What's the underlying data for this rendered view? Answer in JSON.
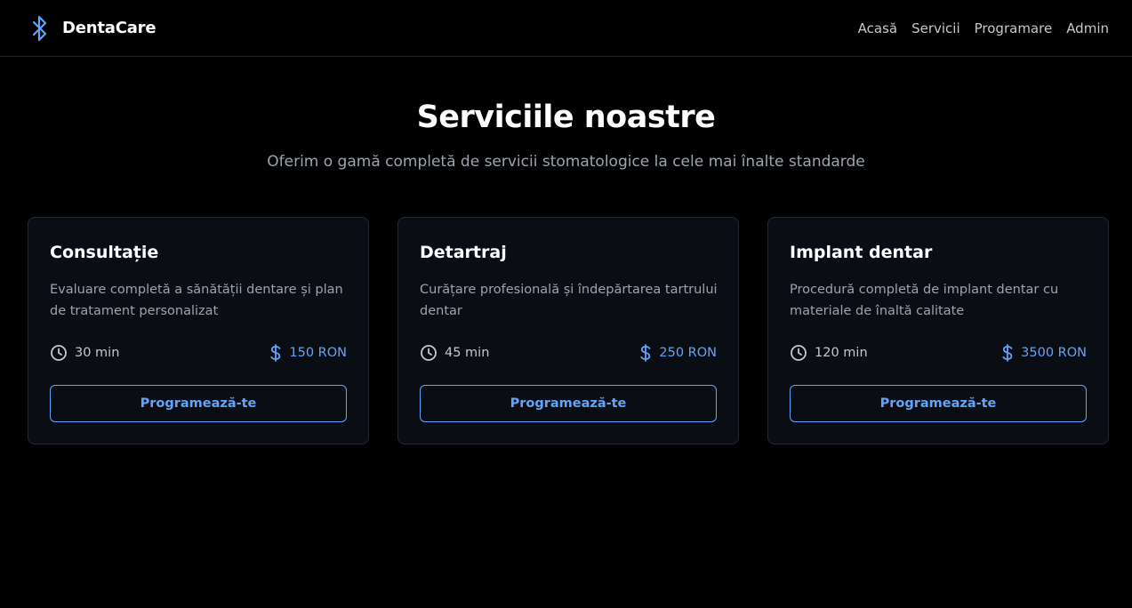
{
  "brand": {
    "name": "DentaCare",
    "icon": "bluetooth-icon"
  },
  "nav": {
    "links": [
      "Acasă",
      "Servicii",
      "Programare",
      "Admin"
    ]
  },
  "hero": {
    "title": "Serviciile noastre",
    "subtitle": "Oferim o gamă completă de servicii stomatologice la cele mai înalte standarde"
  },
  "services": [
    {
      "title": "Consultație",
      "description": "Evaluare completă a sănătății dentare și plan de tratament personalizat",
      "duration": "30 min",
      "price": "150 RON",
      "button": "Programează-te"
    },
    {
      "title": "Detartraj",
      "description": "Curățare profesională și îndepărtarea tartrului dentar",
      "duration": "45 min",
      "price": "250 RON",
      "button": "Programează-te"
    },
    {
      "title": "Implant dentar",
      "description": "Procedură completă de implant dentar cu materiale de înaltă calitate",
      "duration": "120 min",
      "price": "3500 RON",
      "button": "Programează-te"
    }
  ],
  "colors": {
    "background": "#000000",
    "card": "#0a0d14",
    "accent": "#60a5fa",
    "muted": "#9ca3af"
  }
}
